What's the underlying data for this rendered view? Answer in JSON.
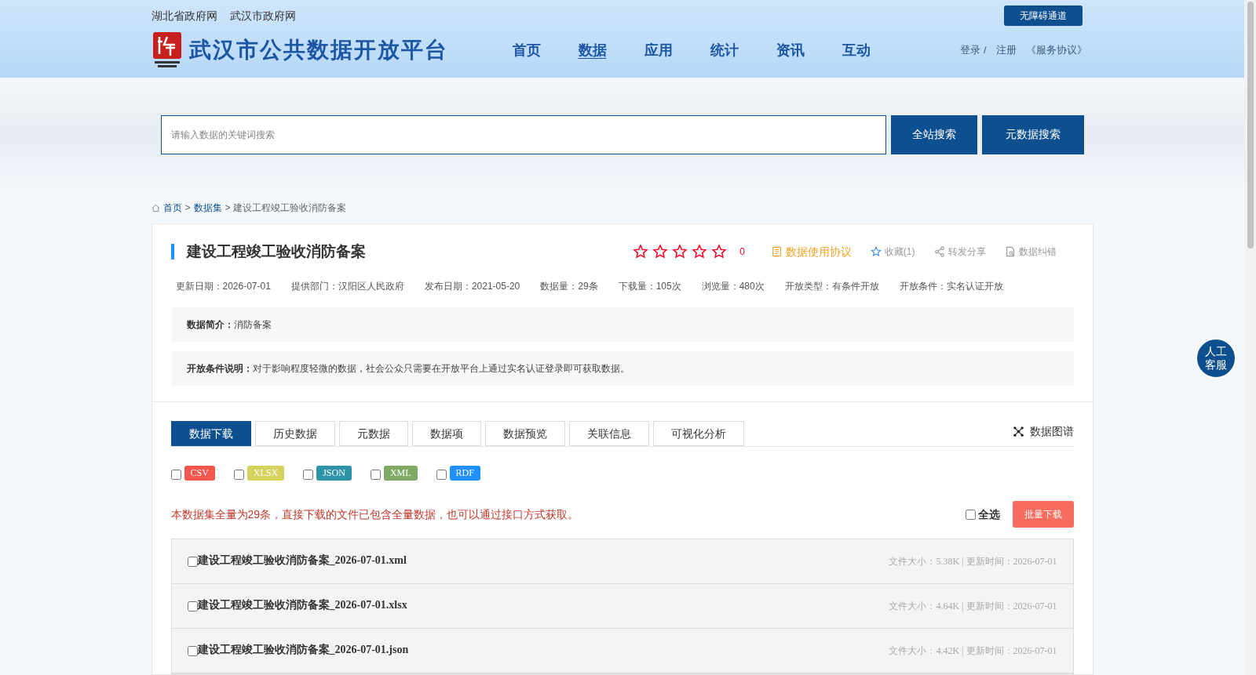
{
  "top_links": [
    "湖北省政府网",
    "武汉市政府网"
  ],
  "accessibility_button": "无障碍通道",
  "site_title": "武汉市公共数据开放平台",
  "nav": [
    {
      "label": "首页",
      "selected": false
    },
    {
      "label": "数据",
      "selected": true
    },
    {
      "label": "应用",
      "selected": false
    },
    {
      "label": "统计",
      "selected": false
    },
    {
      "label": "资讯",
      "selected": false
    },
    {
      "label": "互动",
      "selected": false
    }
  ],
  "user_links": {
    "login": "登录",
    "separator": "/",
    "register": "注册",
    "agreement": "《服务协议》"
  },
  "search": {
    "placeholder": "请输入数据的关键词搜索",
    "buttons": [
      "全站搜索",
      "元数据搜索"
    ]
  },
  "breadcrumb": [
    {
      "label": "首页",
      "link": true
    },
    {
      "label": ">",
      "link": false
    },
    {
      "label": "数据集",
      "link": true
    },
    {
      "label": "> 建设工程竣工验收消防备案",
      "link": false
    }
  ],
  "dataset": {
    "title": "建设工程竣工验收消防备案",
    "stars": 0,
    "rating": "0",
    "actions": [
      {
        "kind": "agreement",
        "label": "数据使用协议"
      },
      {
        "kind": "favorite",
        "label": "收藏(1)"
      },
      {
        "kind": "share",
        "label": "转发分享"
      },
      {
        "kind": "report",
        "label": "数据纠错"
      }
    ],
    "meta": [
      "更新日期：2026-07-01",
      "提供部门：汉阳区人民政府",
      "发布日期：2021-05-20",
      "数据量：29条",
      "下载量：105次",
      "浏览量：480次",
      "开放类型：有条件开放",
      "开放条件：实名认证开放"
    ],
    "info": [
      {
        "label": "数据简介：",
        "text": "消防备案"
      },
      {
        "label": "开放条件说明：",
        "text": "对于影响程度轻微的数据，社会公众只需要在开放平台上通过实名认证登录即可获取数据。"
      }
    ]
  },
  "tabs": [
    {
      "label": "数据下载",
      "selected": true
    },
    {
      "label": "历史数据",
      "selected": false
    },
    {
      "label": "元数据",
      "selected": false
    },
    {
      "label": "数据项",
      "selected": false
    },
    {
      "label": "数据预览",
      "selected": false
    },
    {
      "label": "关联信息",
      "selected": false
    },
    {
      "label": "可视化分析",
      "selected": false
    }
  ],
  "graph_link": "数据图谱",
  "formats": [
    {
      "label": "CSV",
      "color": "#f5564e",
      "checked": false
    },
    {
      "label": "XLSX",
      "color": "#d6d25e",
      "checked": false
    },
    {
      "label": "JSON",
      "color": "#2e93a6",
      "checked": false
    },
    {
      "label": "XML",
      "color": "#7fa965",
      "checked": false
    },
    {
      "label": "RDF",
      "color": "#1e90ff",
      "checked": false
    }
  ],
  "notice": "本数据集全量为29条，直接下载的文件已包含全量数据，也可以通过接口方式获取。",
  "select_all": {
    "label": "全选",
    "checked": false
  },
  "batch_download": "批量下载",
  "files": [
    {
      "name": "建设工程竣工验收消防备案_2026-07-01.xml",
      "info": "文件大小：5.38K | 更新时间：2026-07-01",
      "checked": false
    },
    {
      "name": "建设工程竣工验收消防备案_2026-07-01.xlsx",
      "info": "文件大小：4.64K | 更新时间：2026-07-01",
      "checked": false
    },
    {
      "name": "建设工程竣工验收消防备案_2026-07-01.json",
      "info": "文件大小：4.42K | 更新时间：2026-07-01",
      "checked": false
    }
  ],
  "service_button": "人工客服"
}
